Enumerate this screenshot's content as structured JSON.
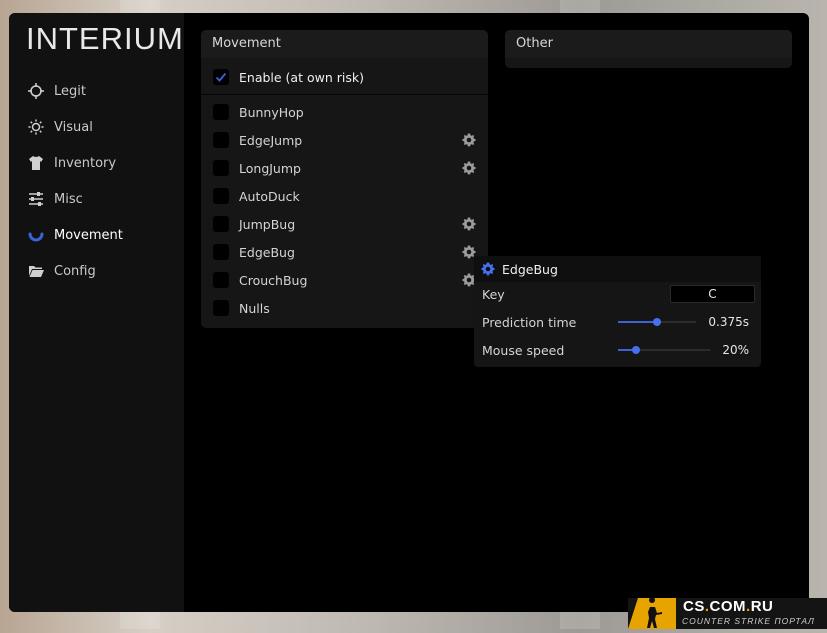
{
  "app": {
    "logo": "INTERIUM"
  },
  "sidebar": {
    "items": [
      {
        "label": "Legit",
        "icon": "crosshair-icon",
        "active": false
      },
      {
        "label": "Visual",
        "icon": "sun-icon",
        "active": false
      },
      {
        "label": "Inventory",
        "icon": "shirt-icon",
        "active": false
      },
      {
        "label": "Misc",
        "icon": "sliders-icon",
        "active": false
      },
      {
        "label": "Movement",
        "icon": "arc-icon",
        "active": true
      },
      {
        "label": "Config",
        "icon": "folder-icon",
        "active": false
      }
    ]
  },
  "movement_panel": {
    "title": "Movement",
    "enable": {
      "label": "Enable (at own risk)",
      "checked": true
    },
    "options": [
      {
        "label": "BunnyHop",
        "checked": false,
        "has_settings": false
      },
      {
        "label": "EdgeJump",
        "checked": false,
        "has_settings": true
      },
      {
        "label": "LongJump",
        "checked": false,
        "has_settings": true
      },
      {
        "label": "AutoDuck",
        "checked": false,
        "has_settings": false
      },
      {
        "label": "JumpBug",
        "checked": false,
        "has_settings": true
      },
      {
        "label": "EdgeBug",
        "checked": false,
        "has_settings": true
      },
      {
        "label": "CrouchBug",
        "checked": false,
        "has_settings": true
      },
      {
        "label": "Nulls",
        "checked": false,
        "has_settings": false
      }
    ]
  },
  "other_panel": {
    "title": "Other"
  },
  "edgebug_popup": {
    "title": "EdgeBug",
    "key": {
      "label": "Key",
      "value": "C"
    },
    "prediction_time": {
      "label": "Prediction time",
      "value_text": "0.375s",
      "fraction": 0.5
    },
    "mouse_speed": {
      "label": "Mouse speed",
      "value_text": "20%",
      "fraction": 0.2
    }
  },
  "watermark": {
    "title_a": "CS",
    "title_dot": ".",
    "title_b": "COM",
    "title_dot2": ".",
    "title_c": "RU",
    "subtitle": "COUNTER STRIKE ПОРТАЛ"
  },
  "colors": {
    "accent": "#3a63d8",
    "window_bg": "#000000",
    "sidebar_bg": "#111112",
    "badge_accent": "#e7a400"
  }
}
